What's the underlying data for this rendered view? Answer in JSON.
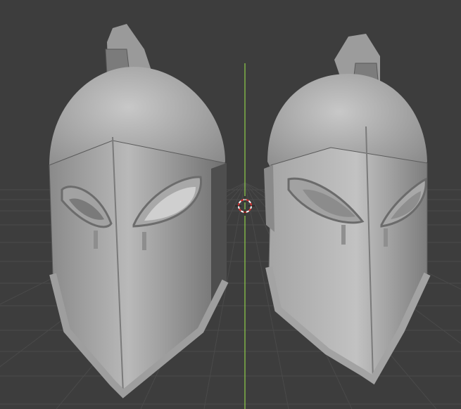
{
  "viewport": {
    "background": "#3d3d3d",
    "grid_color": "#4a4a4a",
    "y_axis_color": "#8fcf4a"
  },
  "objects": [
    {
      "name": "helmet-left",
      "shading": "smooth"
    },
    {
      "name": "helmet-right",
      "shading": "sculpted-detail"
    }
  ],
  "cursor": {
    "icon": "3d-cursor-icon",
    "colors": [
      "#e03030",
      "#ffffff"
    ]
  }
}
